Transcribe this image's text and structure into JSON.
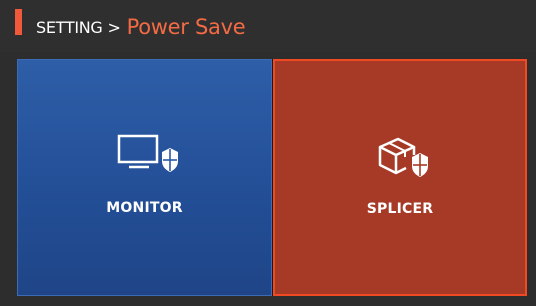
{
  "header": {
    "parent": "SETTING",
    "separator": ">",
    "current": "Power Save",
    "accent_color": "#f05a3a"
  },
  "tiles": [
    {
      "label": "MONITOR",
      "icon": "monitor-shield-icon",
      "color": "#2a5aa6",
      "selected": false
    },
    {
      "label": "SPLICER",
      "icon": "box-shield-icon",
      "color": "#a63a26",
      "selected": true
    }
  ]
}
